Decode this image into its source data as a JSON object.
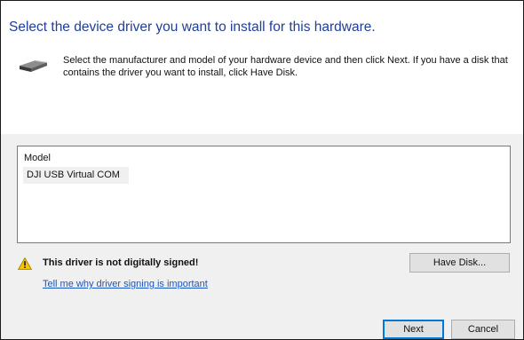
{
  "heading": "Select the device driver you want to install for this hardware.",
  "instructions": "Select the manufacturer and model of your hardware device and then click Next. If you have a disk that contains the driver you want to install, click Have Disk.",
  "hardware_icon": "hardware-device-icon",
  "model_list": {
    "header": "Model",
    "items": [
      "DJI USB Virtual COM"
    ],
    "selected_index": 0
  },
  "warning": {
    "icon": "warning-icon",
    "text": "This driver is not digitally signed!",
    "link": "Tell me why driver signing is important"
  },
  "buttons": {
    "have_disk": "Have Disk...",
    "next": "Next",
    "cancel": "Cancel"
  },
  "colors": {
    "heading": "#1f3f9a",
    "link": "#1a55c4",
    "warning": "#f5c400",
    "default_button_border": "#0078d7"
  }
}
